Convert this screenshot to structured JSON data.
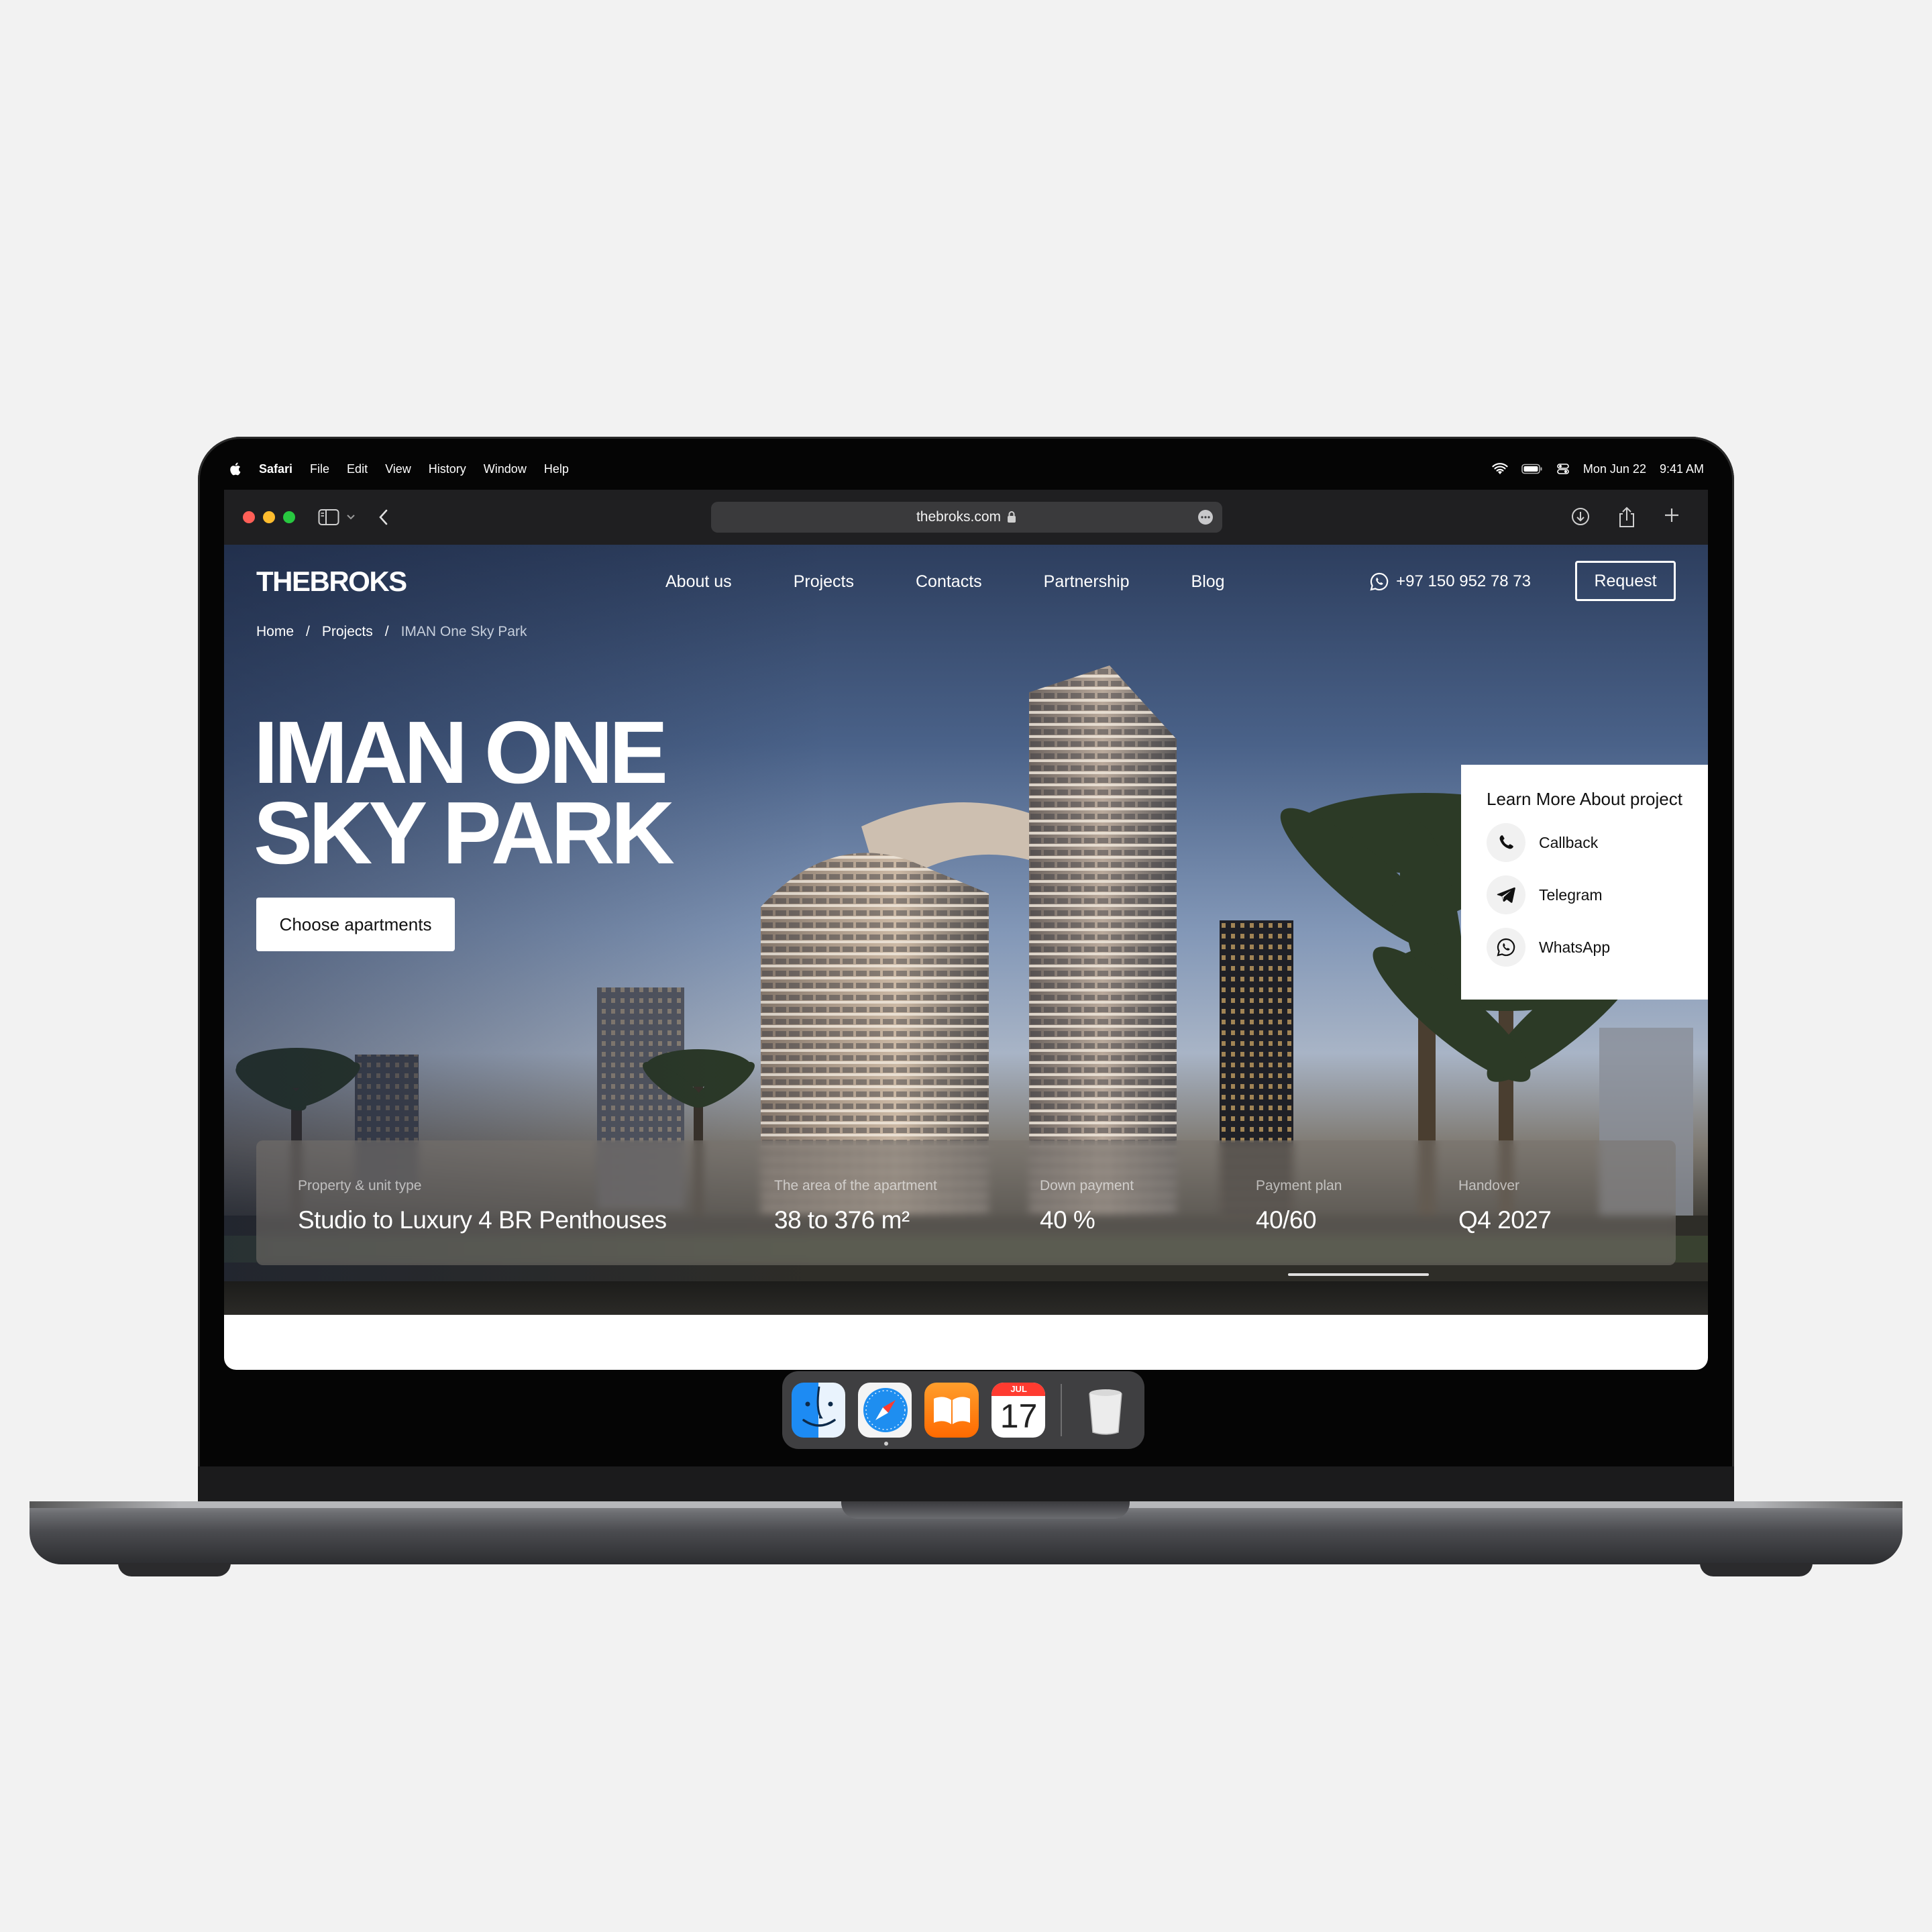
{
  "menubar": {
    "app": "Safari",
    "items": [
      "File",
      "Edit",
      "View",
      "History",
      "Window",
      "Help"
    ],
    "date": "Mon Jun 22",
    "time": "9:41 AM"
  },
  "browser": {
    "url": "thebroks.com"
  },
  "site": {
    "logo": "THEBROKS",
    "nav": [
      "About us",
      "Projects",
      "Contacts",
      "Partnership",
      "Blog"
    ],
    "phone": "+97 150 952 78 73",
    "request_label": "Request"
  },
  "breadcrumb": {
    "home": "Home",
    "projects": "Projects",
    "current": "IMAN One Sky Park",
    "separator": "/"
  },
  "hero": {
    "title_line1": "IMAN ONE",
    "title_line2": "SKY PARK",
    "cta": "Choose apartments"
  },
  "learn_more": {
    "title": "Learn More About project",
    "items": [
      {
        "label": "Callback",
        "icon": "phone-icon"
      },
      {
        "label": "Telegram",
        "icon": "telegram-icon"
      },
      {
        "label": "WhatsApp",
        "icon": "whatsapp-icon"
      }
    ]
  },
  "specs": [
    {
      "label": "Property & unit type",
      "value": "Studio to Luxury 4 BR Penthouses"
    },
    {
      "label": "The area of the apartment",
      "value": "38 to 376 m²"
    },
    {
      "label": "Down payment",
      "value": "40 %"
    },
    {
      "label": "Payment plan",
      "value": "40/60"
    },
    {
      "label": "Handover",
      "value": "Q4 2027"
    }
  ],
  "dock": {
    "apps": [
      "finder-icon",
      "safari-icon",
      "books-icon",
      "calendar-icon",
      "trash-icon"
    ],
    "calendar_month": "JUL",
    "calendar_day": "17"
  },
  "colors": {
    "page_bg": "#f2f2f2",
    "hero_sky": "#4a6289",
    "traffic_red": "#ff5f57",
    "traffic_yellow": "#febc2e",
    "traffic_green": "#28c840"
  }
}
